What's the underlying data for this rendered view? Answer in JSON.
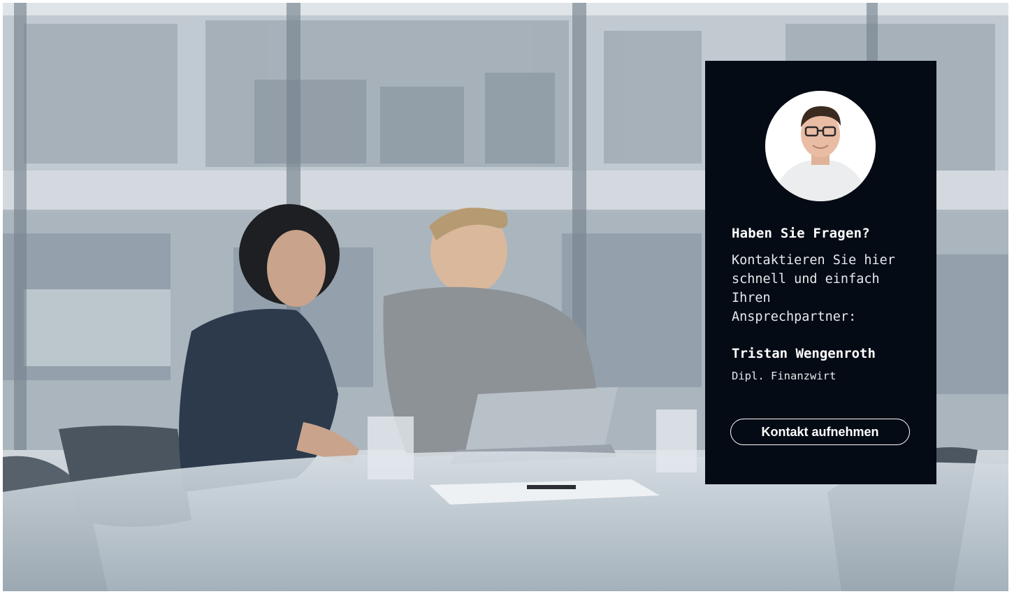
{
  "hero": {
    "image": "office-meeting-photo"
  },
  "contact_card": {
    "avatar": "contact-person-avatar",
    "heading": "Haben Sie Fragen?",
    "text": "Kontaktieren Sie hier schnell und einfach Ihren Ansprechpartner:",
    "name": "Tristan Wengenroth",
    "title": "Dipl. Finanzwirt",
    "button_label": "Kontakt aufnehmen",
    "background_color": "#040b14"
  }
}
